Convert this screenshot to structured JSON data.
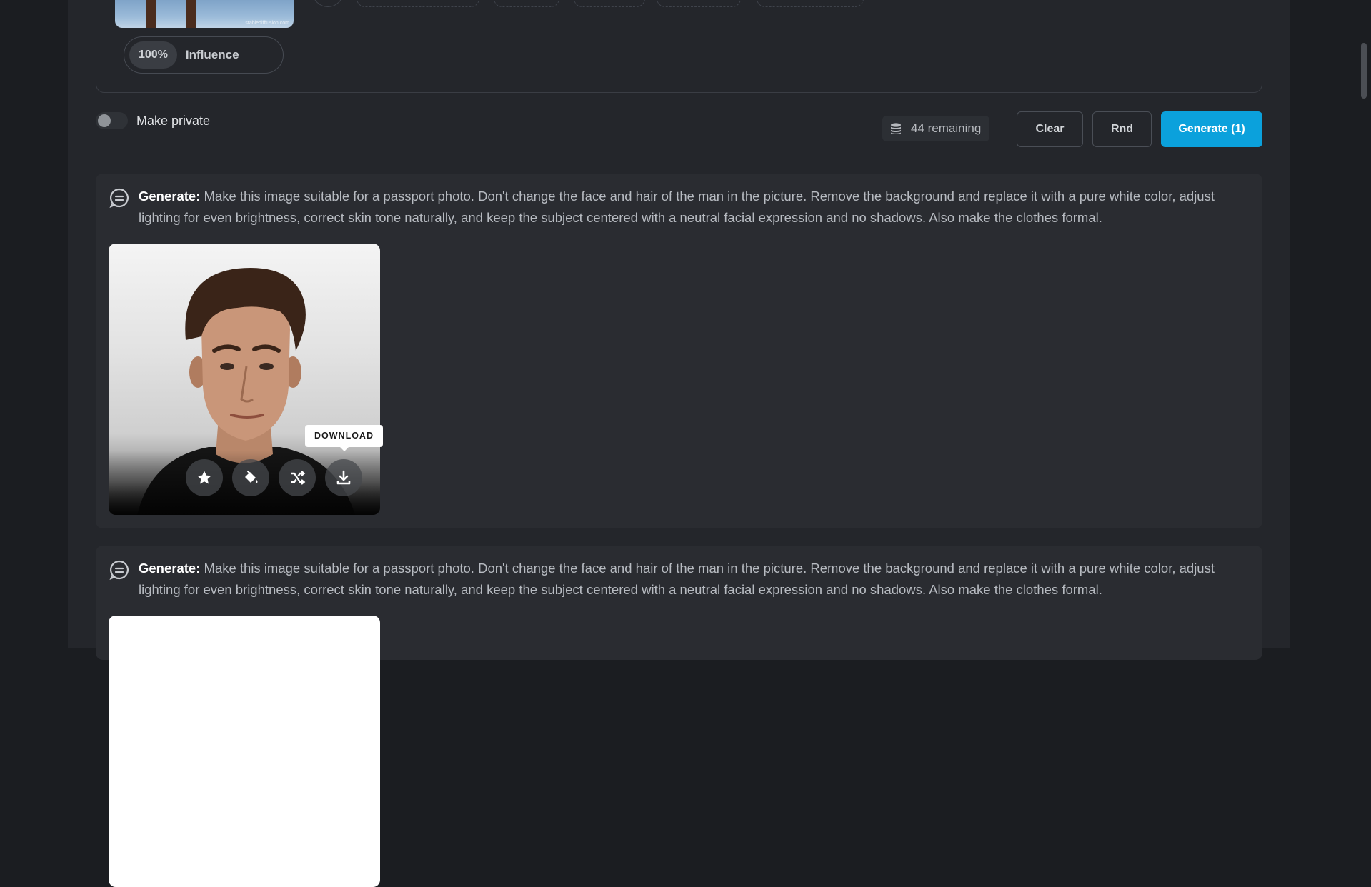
{
  "reference": {
    "influence_percent": "100%",
    "influence_label": "Influence",
    "thumb_watermark": "stabledifffusion.com"
  },
  "controls": {
    "private_label": "Make private",
    "private_on": false,
    "remaining_label": "44 remaining",
    "clear_label": "Clear",
    "rnd_label": "Rnd",
    "generate_label": "Generate (1)"
  },
  "generations": [
    {
      "prefix": "Generate:",
      "prompt": " Make this image suitable for a passport photo. Don't change the face and hair of the man in the picture. Remove the background and replace it with a pure white color, adjust lighting for even brightness, correct skin tone naturally, and keep the subject centered with a neutral facial expression and no shadows. Also make the clothes formal.",
      "tooltip": "DOWNLOAD"
    },
    {
      "prefix": "Generate:",
      "prompt": " Make this image suitable for a passport photo. Don't change the face and hair of the man in the picture. Remove the background and replace it with a pure white color, adjust lighting for even brightness, correct skin tone naturally, and keep the subject centered with a neutral facial expression and no shadows. Also make the clothes formal."
    }
  ],
  "colors": {
    "background": "#1b1d21",
    "panel": "#24262b",
    "card": "#2a2c31",
    "accent": "#0ba1dc"
  },
  "icons": {
    "remaining": "coins-stack-icon",
    "prompt": "chat-bubble-icon",
    "actions": [
      "star-icon",
      "paint-bucket-icon",
      "shuffle-icon",
      "download-icon"
    ]
  }
}
